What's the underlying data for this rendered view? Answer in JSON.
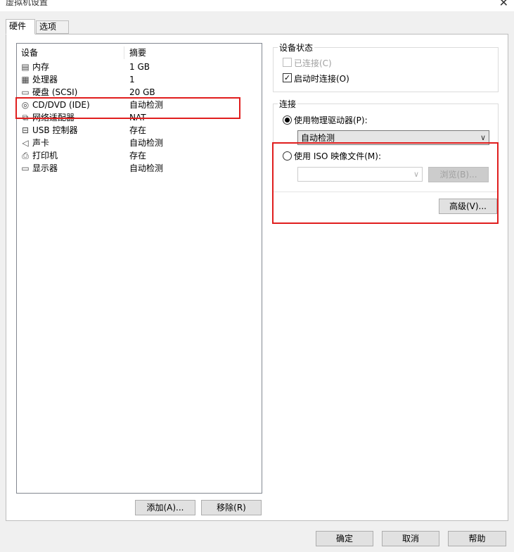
{
  "window": {
    "title": "虚拟机设置",
    "close_glyph": "✕"
  },
  "tabs": [
    {
      "label": "硬件",
      "active": true
    },
    {
      "label": "选项",
      "active": false
    }
  ],
  "device_list": {
    "columns": [
      "设备",
      "摘要"
    ],
    "rows": [
      {
        "icon": "memory-icon",
        "glyph": "▤",
        "name": "内存",
        "summary": "1 GB"
      },
      {
        "icon": "cpu-icon",
        "glyph": "▦",
        "name": "处理器",
        "summary": "1"
      },
      {
        "icon": "hard-disk-icon",
        "glyph": "▭",
        "name": "硬盘 (SCSI)",
        "summary": "20 GB"
      },
      {
        "icon": "cd-dvd-icon",
        "glyph": "◎",
        "name": "CD/DVD (IDE)",
        "summary": "自动检测"
      },
      {
        "icon": "network-adapter-icon",
        "glyph": "⧉",
        "name": "网络适配器",
        "summary": "NAT"
      },
      {
        "icon": "usb-icon",
        "glyph": "⊟",
        "name": "USB 控制器",
        "summary": "存在"
      },
      {
        "icon": "speaker-icon",
        "glyph": "◁",
        "name": "声卡",
        "summary": "自动检测"
      },
      {
        "icon": "printer-icon",
        "glyph": "⎙",
        "name": "打印机",
        "summary": "存在"
      },
      {
        "icon": "display-icon",
        "glyph": "▭",
        "name": "显示器",
        "summary": "自动检测"
      }
    ],
    "add_button": "添加(A)...",
    "remove_button": "移除(R)"
  },
  "device_status": {
    "title": "设备状态",
    "connected_label": "已连接(C)",
    "connected_checked": false,
    "connected_disabled": true,
    "connect_at_power_on_label": "启动时连接(O)",
    "connect_at_power_on_checked": true,
    "check_glyph": "✓"
  },
  "connection": {
    "title": "连接",
    "physical_drive_label": "使用物理驱动器(P):",
    "physical_drive_selected": true,
    "physical_drive_value": "自动检测",
    "iso_label": "使用 ISO 映像文件(M):",
    "iso_selected": false,
    "iso_value": "",
    "browse_button": "浏览(B)...",
    "advanced_button": "高级(V)...",
    "dropdown_glyph": "∨"
  },
  "footer": {
    "ok": "确定",
    "cancel": "取消",
    "help": "帮助"
  },
  "colors": {
    "highlight_red": "#e01e1e",
    "window_bg": "#f0f0f0",
    "button_bg": "#e1e1e1"
  }
}
